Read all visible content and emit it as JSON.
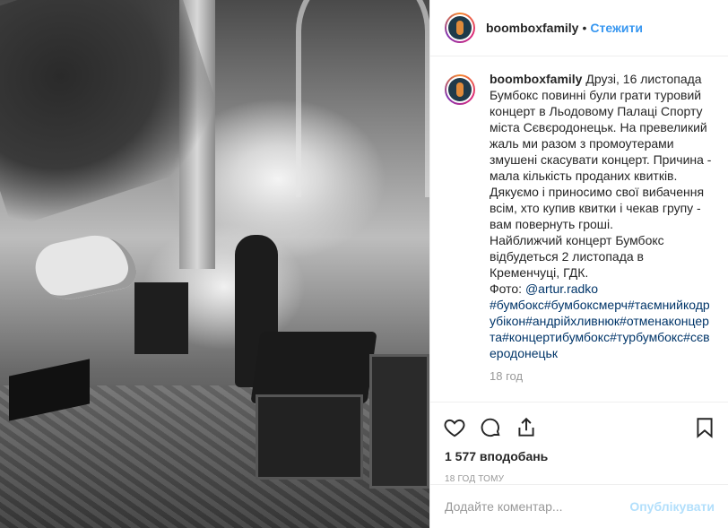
{
  "post": {
    "photo_alt": "",
    "header": {
      "username": "boomboxfamily",
      "separator": "•",
      "follow_label": "Стежити"
    },
    "caption": {
      "username": "boomboxfamily",
      "text": "Друзі, 16 листопада Бумбокс повинні були грати туровий концерт в Льодовому Палаці Спорту міста Сєвєродонецьк. На превеликий жаль ми разом з промоутерами змушені скасувати концерт. Причина - мала кількість проданих квитків. Дякуємо і приносимо свої вибачення всім, хто купив квитки і чекав групу - вам повернуть гроші.\nНайближчий концерт Бумбокс відбудеться 2 листопада в Кременчуці, ГДК.",
      "photo_credit_label": "Фото: ",
      "photo_credit_handle": "@artur.radko",
      "hashtags": "#бумбокс#бумбоксмерч#таємнийкодрубікон#андрійхливнюк#отменаконцерта#концертибумбокс#турбумбокс#сєверодонецьк",
      "time": "18 год"
    },
    "actions": {
      "like_icon": "heart-icon",
      "comment_icon": "comment-icon",
      "share_icon": "share-icon",
      "save_icon": "bookmark-icon"
    },
    "likes": "1 577 вподобань",
    "time_ago": "18 ГОД ТОМУ",
    "comment_box": {
      "placeholder": "Додайте коментар...",
      "post_label": "Опублікувати"
    }
  },
  "colors": {
    "link": "#3897f0",
    "post_disabled": "#b2dffc",
    "border": "#efefef"
  }
}
